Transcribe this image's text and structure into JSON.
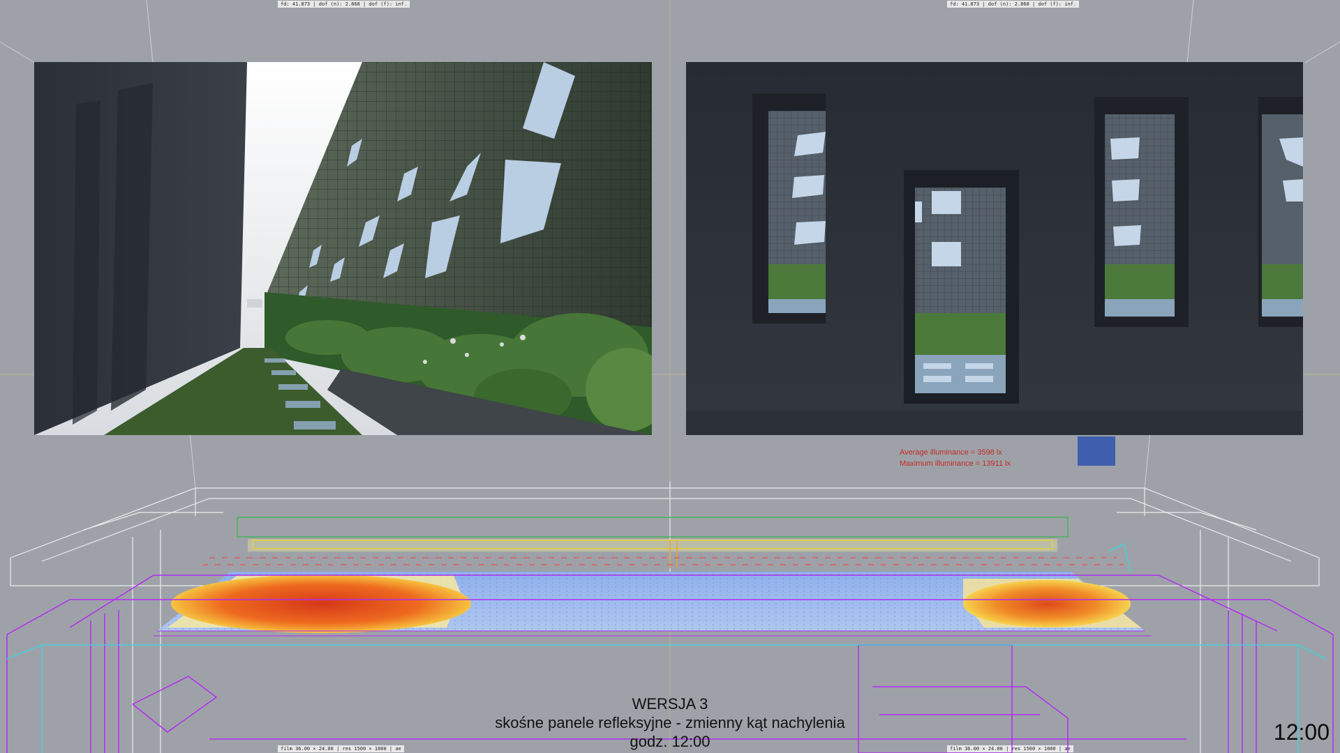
{
  "viewport_stamps": {
    "top_left": "fd: 41.873  |  dof (n): 2.868  |  dof (f): inf.",
    "top_right": "fd: 41.873  |  dof (n): 2.868  |  dof (f): inf.",
    "bottom_left": "film 36.00 × 24.00  |  res 1500 × 1000  |  ae",
    "bottom_right": "film 36.00 × 24.00  |  res 1500 × 1000  |  ae"
  },
  "renders": {
    "left": "courtyard-perspective-render",
    "right": "interior-windows-render"
  },
  "illuminance": {
    "average": "Average illuminance = 3598 lx",
    "maximum": "Maximum illuminance = 13911 lx",
    "swatch_color": "#3f5fae"
  },
  "caption": {
    "version": "WERSJA 3",
    "description": "skośne panele refleksyjne - zmienny kąt nachylenia",
    "time": "godz. 12:00"
  },
  "clock": "12:00",
  "colors": {
    "background": "#9ea2a8",
    "wireframe_magenta": "#b12cf0",
    "wireframe_cyan": "#35d6e6",
    "wireframe_white": "#f3f3f3",
    "heat_hot": "#e0401c",
    "heat_warm": "#f7b62a",
    "heat_cool": "#7ea2e8"
  }
}
